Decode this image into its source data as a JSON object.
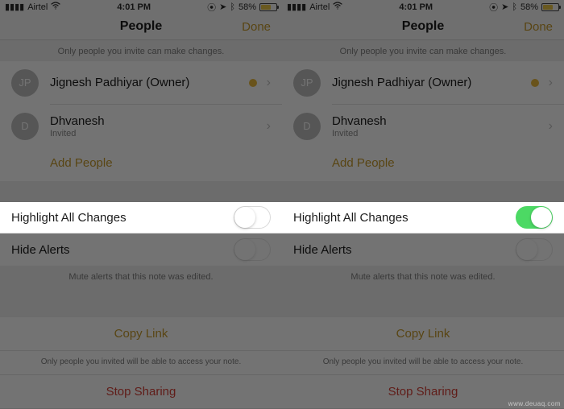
{
  "statusbar": {
    "carrier": "Airtel",
    "time": "4:01 PM",
    "battery_pct": "58%"
  },
  "nav": {
    "title": "People",
    "done": "Done"
  },
  "hint_top": "Only people you invite can make changes.",
  "people": {
    "owner": {
      "initials": "JP",
      "name": "Jignesh Padhiyar (Owner)"
    },
    "invited": {
      "initials": "D",
      "name": "Dhvanesh",
      "status": "Invited"
    },
    "add": "Add People"
  },
  "settings": {
    "highlight": "Highlight All Changes",
    "hide_alerts": "Hide Alerts",
    "mute_note": "Mute alerts that this note was edited."
  },
  "actions": {
    "copy": "Copy Link",
    "access_note": "Only people you invited will be able to access your note.",
    "stop": "Stop Sharing"
  },
  "watermark": "www.deuaq.com"
}
